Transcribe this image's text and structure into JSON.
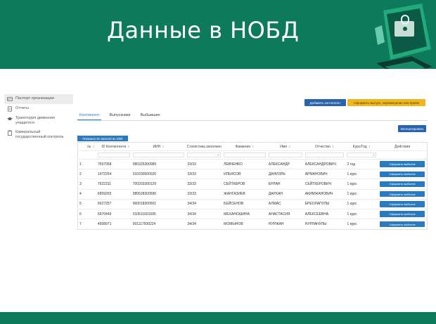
{
  "banner": {
    "title": "Данные в НОБД"
  },
  "sidebar": {
    "items": [
      {
        "label": "Паспорт организации",
        "icon": "id-card-icon"
      },
      {
        "label": "Отчеты",
        "icon": "document-icon"
      },
      {
        "label": "Траектория движения учащегося",
        "icon": "graduation-cap-icon"
      },
      {
        "label": "Камеральный государственный контроль",
        "icon": "clipboard-icon"
      }
    ]
  },
  "toolbar": {
    "add_contingent": "Добавить контингент",
    "graduation": "Оформить выпуск, перемещение или приём",
    "export": "Экспортировать"
  },
  "tabs": [
    "Контингент",
    "Выпускники",
    "Выбывшие"
  ],
  "table": {
    "count_label": "Показано 25 записей из 1000",
    "headers": [
      "№",
      "ID Контингента",
      "ИИН",
      "Статистика заполнен",
      "Фамилия",
      "Имя",
      "Отчество",
      "Курс/Год",
      "Действия"
    ],
    "action_label": "Оформить выбытие",
    "rows": [
      [
        "1",
        "7597058",
        "980325300089",
        "33/33",
        "ЛЕВЧЕНКО",
        "АЛЕКСАНДР",
        "АЛЕКСАНДРОВИЧ",
        "2 год"
      ],
      [
        "2",
        "1472254",
        "010330500026",
        "33/33",
        "ИЛЬЯСОВ",
        "ДАНИЭЛЬ",
        "АРМАНОВИЧ",
        "1 курс"
      ],
      [
        "3",
        "7522311",
        "700203300129",
        "33/33",
        "СЕЙТКЕРОВ",
        "ЕРЛАН",
        "СЕЙТКЕРОВИЧ",
        "1 курс"
      ],
      [
        "4",
        "6859265",
        "980528300590",
        "33/33",
        "ЖАНГАЗИЕВ",
        "ДАРХАН",
        "АКИМЖАНОВИЧ",
        "1 курс"
      ],
      [
        "5",
        "6627257",
        "960018300501",
        "34/34",
        "БЕЙСЕНОВ",
        "АЛМАС",
        "ЕРЕОЛАПУЛЫ",
        "1 курс"
      ],
      [
        "6",
        "6970449",
        "010611601695",
        "34/34",
        "МЕХАНОШИНА",
        "АНАСТАСИЯ",
        "АЛЕКСЕЕВНА",
        "1 курс"
      ],
      [
        "7",
        "4508971",
        "001117500224",
        "34/34",
        "МОМЫНОВ",
        "НУРЖАН",
        "НУРЛАНУЛЫ",
        "1 курс"
      ]
    ]
  },
  "colors": {
    "brand_green": "#0e7a5c",
    "primary_blue": "#2a63ad",
    "accent_yellow": "#f1b51f"
  }
}
